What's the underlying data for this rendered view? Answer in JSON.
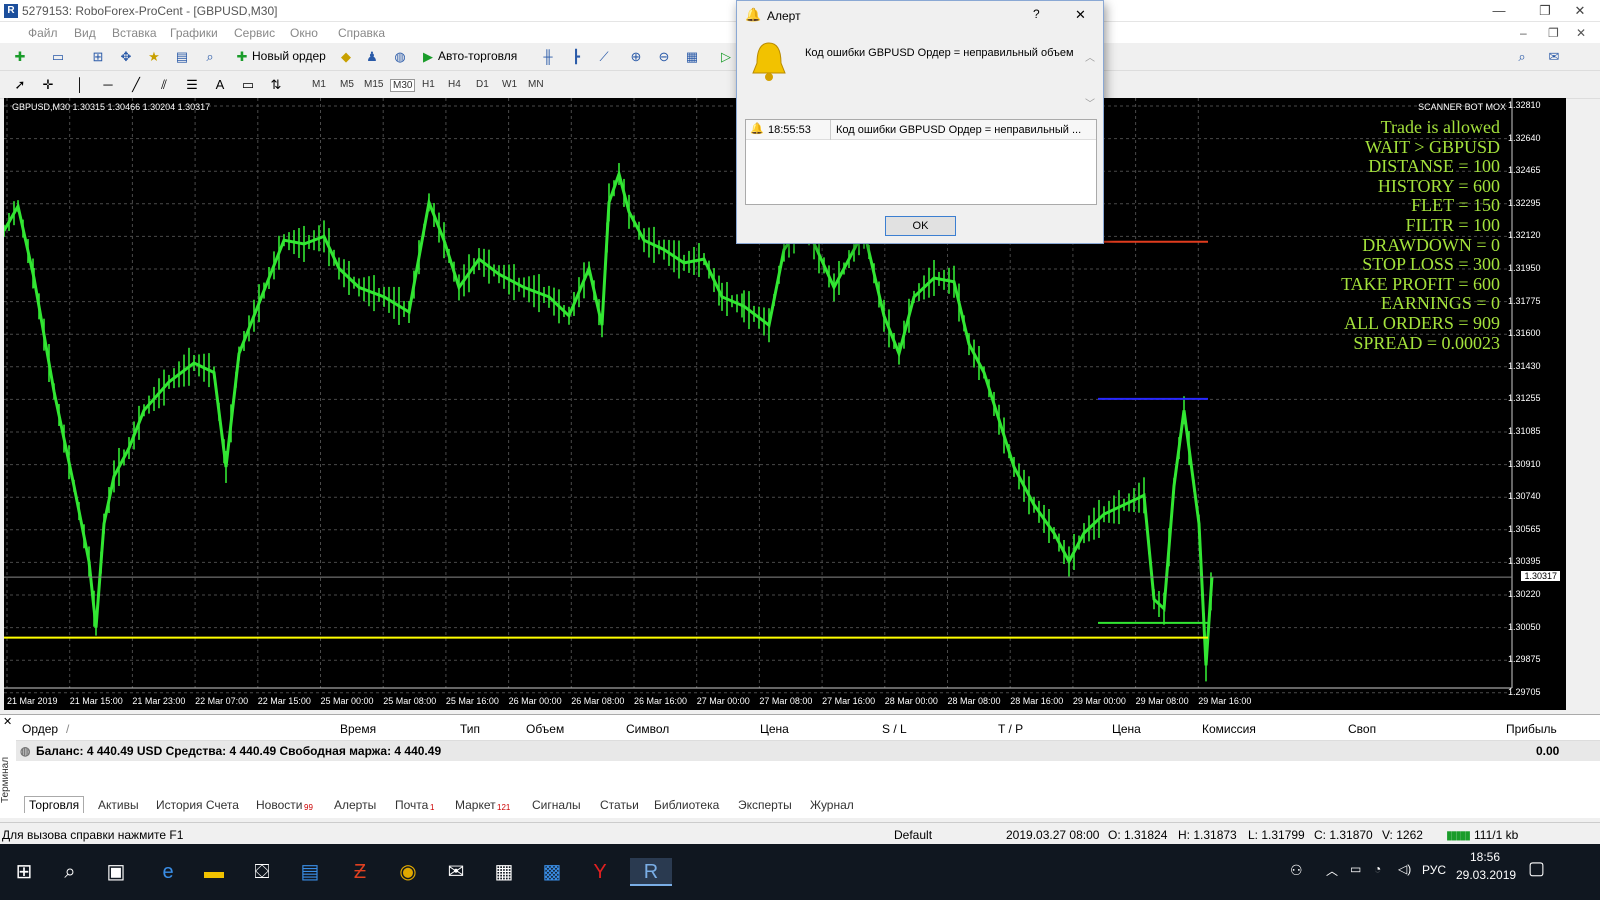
{
  "window": {
    "title": "5279153: RoboForex-ProCent - [GBPUSD,M30]",
    "min": "—",
    "max": "❐",
    "close": "✕"
  },
  "menu": [
    "Файл",
    "Вид",
    "Вставка",
    "Графики",
    "Сервис",
    "Окно",
    "Справка"
  ],
  "toolbar": {
    "new_order": "Новый ордер",
    "auto_trade": "Авто-торговля"
  },
  "timeframes": [
    "M1",
    "M5",
    "M15",
    "M30",
    "H1",
    "H4",
    "D1",
    "W1",
    "MN"
  ],
  "chart": {
    "symbol_label": "GBPUSD,M30  1.30315 1.30466 1.30204 1.30317",
    "bot_name": "SCANNER BOT MOX",
    "info_lines": [
      "Trade is allowed",
      "WAIT > GBPUSD",
      "DISTANSE = 100",
      "HISTORY = 600",
      "FLET = 150",
      "FILTR  = 100",
      "DRAWDOWN  = 0",
      "STOP LOSS = 300",
      "TAKE PROFIT = 600",
      "EARNINGS  = 0",
      "ALL ORDERS = 909",
      "SPREAD =  0.00023"
    ],
    "y_ticks": [
      "1.32810",
      "1.32640",
      "1.32465",
      "1.32295",
      "1.32120",
      "1.31950",
      "1.31775",
      "1.31600",
      "1.31430",
      "1.31255",
      "1.31085",
      "1.30910",
      "1.30740",
      "1.30565",
      "1.30395",
      "1.30220",
      "1.30050",
      "1.29875",
      "1.29705"
    ],
    "current_price": "1.30317",
    "x_ticks": [
      "21 Mar 2019",
      "21 Mar 15:00",
      "21 Mar 23:00",
      "22 Mar 07:00",
      "22 Mar 15:00",
      "25 Mar 00:00",
      "25 Mar 08:00",
      "25 Mar 16:00",
      "26 Mar 00:00",
      "26 Mar 08:00",
      "26 Mar 16:00",
      "27 Mar 00:00",
      "27 Mar 08:00",
      "27 Mar 16:00",
      "28 Mar 00:00",
      "28 Mar 08:00",
      "28 Mar 16:00",
      "29 Mar 00:00",
      "29 Mar 08:00",
      "29 Mar 16:00"
    ],
    "colors": {
      "candles": "#32e632",
      "yellow_line": "#ffff00",
      "red_line": "#e03c1e",
      "blue_line": "#2828ff",
      "green_line": "#32e632",
      "info_text": "#a4e23c"
    }
  },
  "dialog": {
    "title": "Алерт",
    "help": "?",
    "close": "✕",
    "message": "Код ошибки GBPUSD  Ордер   =  неправильный объем",
    "row_time": "18:55:53",
    "row_text": "Код ошибки GBPUSD  Ордер   =  неправильный ...",
    "ok": "OK"
  },
  "terminal": {
    "side_label": "Терминал",
    "headers": [
      "Ордер",
      "/",
      "Время",
      "Тип",
      "Объем",
      "Символ",
      "Цена",
      "S / L",
      "T / P",
      "Цена",
      "Комиссия",
      "Своп",
      "Прибыль"
    ],
    "balance": "Баланс: 4 440.49 USD  Средства: 4 440.49  Свободная маржа: 4 440.49",
    "profit": "0.00",
    "tabs": [
      "Торговля",
      "Активы",
      "История Счета",
      "Новости",
      "Алерты",
      "Почта",
      "Маркет",
      "Сигналы",
      "Статьи",
      "Библиотека",
      "Эксперты",
      "Журнал"
    ],
    "badges": {
      "news": "99",
      "mail": "1",
      "market": "121"
    }
  },
  "status": {
    "help": "Для вызова справки нажмите F1",
    "profile": "Default",
    "time": "2019.03.27 08:00",
    "open": "O: 1.31824",
    "high": "H: 1.31873",
    "low": "L: 1.31799",
    "close": "C: 1.31870",
    "volume": "V: 1262",
    "traffic": "111/1 kb"
  },
  "taskbar": {
    "lang": "РУС",
    "time": "18:56",
    "date": "29.03.2019"
  }
}
